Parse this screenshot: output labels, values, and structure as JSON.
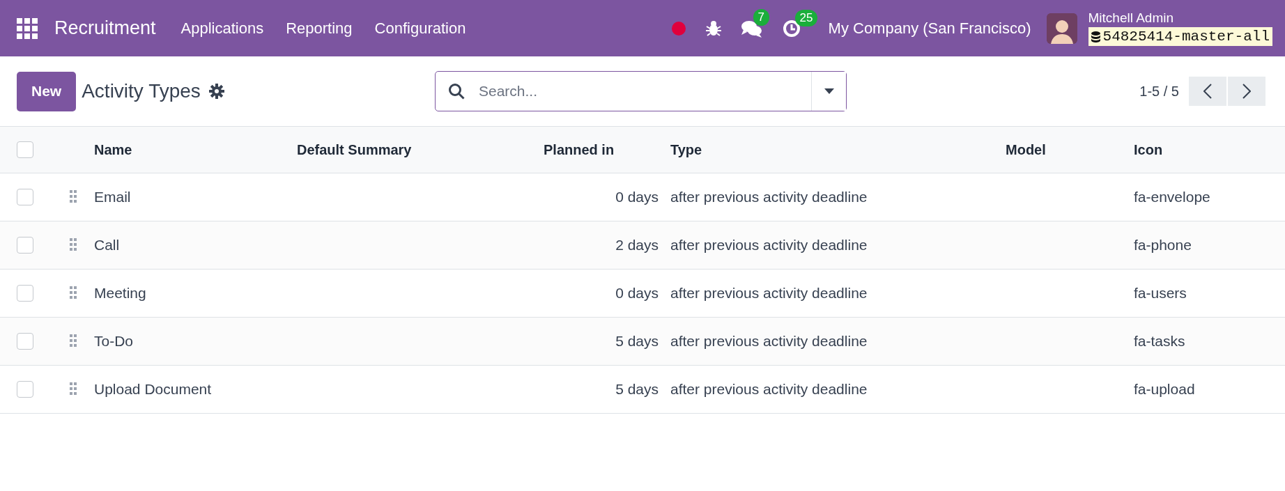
{
  "navbar": {
    "app_name": "Recruitment",
    "menus": [
      "Applications",
      "Reporting",
      "Configuration"
    ],
    "messages_count": "7",
    "activities_count": "25",
    "company": "My Company (San Francisco)",
    "user_name": "Mitchell Admin",
    "database": "54825414-master-all"
  },
  "control_panel": {
    "new_button": "New",
    "title": "Activity Types",
    "search": {
      "placeholder": "Search..."
    },
    "pager": "1-5 / 5"
  },
  "table": {
    "select_all_checked": false,
    "columns": [
      "Name",
      "Default Summary",
      "Planned in",
      "Type",
      "Model",
      "Icon"
    ],
    "rows": [
      {
        "checked": false,
        "name": "Email",
        "planned_in": "0 days",
        "type": "after previous activity deadline",
        "icon": "fa-envelope"
      },
      {
        "checked": false,
        "name": "Call",
        "planned_in": "2 days",
        "type": "after previous activity deadline",
        "icon": "fa-phone"
      },
      {
        "checked": false,
        "name": "Meeting",
        "planned_in": "0 days",
        "type": "after previous activity deadline",
        "icon": "fa-users"
      },
      {
        "checked": false,
        "name": "To-Do",
        "planned_in": "5 days",
        "type": "after previous activity deadline",
        "icon": "fa-tasks"
      },
      {
        "checked": false,
        "name": "Upload Document",
        "planned_in": "5 days",
        "type": "after previous activity deadline",
        "icon": "fa-upload"
      }
    ]
  }
}
